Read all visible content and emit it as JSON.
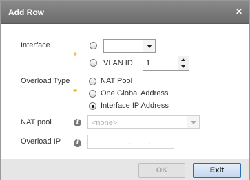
{
  "dialog": {
    "title": "Add Row",
    "close_glyph": "✕"
  },
  "form": {
    "interface_label": "Interface",
    "interface_select_value": "",
    "vlan_label": "VLAN ID",
    "vlan_value": "1",
    "overload_type_label": "Overload Type",
    "overload_options": [
      "NAT Pool",
      "One Global Address",
      "Interface IP Address"
    ],
    "overload_selected": "Interface IP Address",
    "nat_pool_label": "NAT pool",
    "nat_pool_value": "<none>",
    "overload_ip_label": "Overload IP",
    "overload_ip_value": ". . ."
  },
  "footer": {
    "ok_label": "OK",
    "exit_label": "Exit"
  },
  "colors": {
    "required_star": "#f0a000",
    "title_bar": "#7a7a7a",
    "exit_border": "#2a6db3"
  },
  "icons": {
    "required": "asterisk-icon",
    "info": "info-icon",
    "close": "close-icon",
    "dropdown": "chevron-down-icon"
  }
}
